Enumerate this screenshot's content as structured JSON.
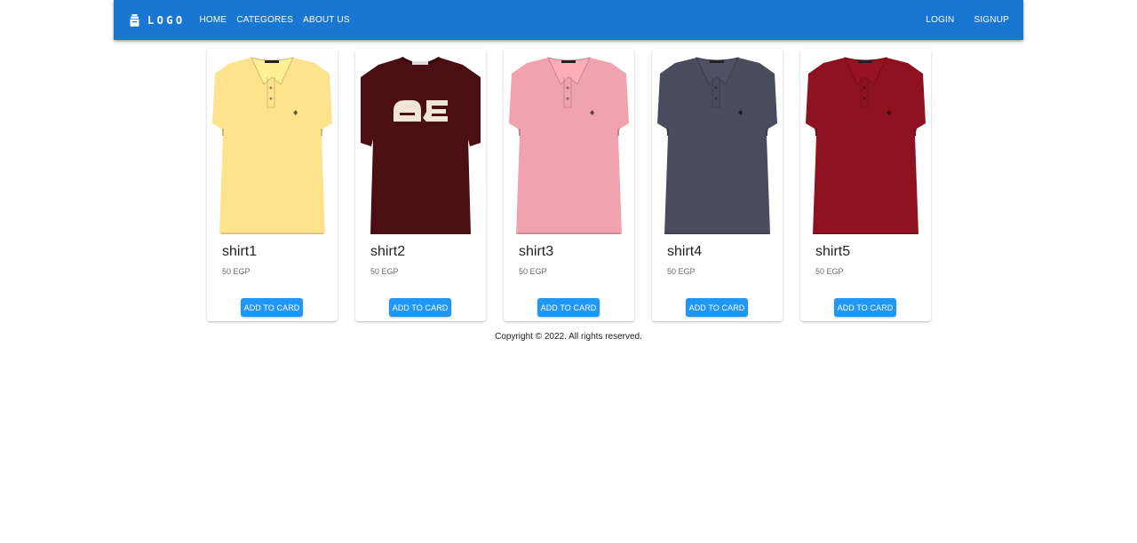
{
  "nav": {
    "brand": "LOGO",
    "links": [
      "HOME",
      "CATEGORES",
      "ABOUT US"
    ],
    "auth": [
      "LOGIN",
      "SIGNUP"
    ]
  },
  "products": [
    {
      "name": "shirt1",
      "price": "50 EGP",
      "button": "ADD TO CARD",
      "color": "#fee38c",
      "style": "polo"
    },
    {
      "name": "shirt2",
      "price": "50 EGP",
      "button": "ADD TO CARD",
      "color": "#4a0e13",
      "style": "tee",
      "print": "AE"
    },
    {
      "name": "shirt3",
      "price": "50 EGP",
      "button": "ADD TO CARD",
      "color": "#f0a3ae",
      "style": "polo"
    },
    {
      "name": "shirt4",
      "price": "50 EGP",
      "button": "ADD TO CARD",
      "color": "#4b4b5e",
      "style": "polo"
    },
    {
      "name": "shirt5",
      "price": "50 EGP",
      "button": "ADD TO CARD",
      "color": "#8e1120",
      "style": "polo"
    }
  ],
  "footer": {
    "text": "Copyright © 2022. All rights reserved."
  },
  "colors": {
    "navbar": "#1976d2",
    "button": "#2196f3"
  }
}
